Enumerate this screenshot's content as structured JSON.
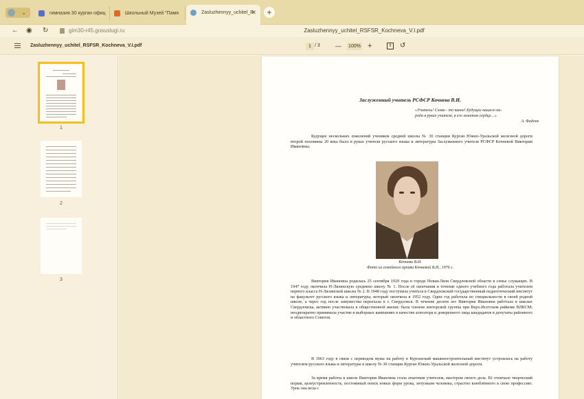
{
  "browser": {
    "tabs": [
      {
        "label": "гимназия 30 курган офиц",
        "favicon_color": "#5b6ec4"
      },
      {
        "label": "Школьный Музей \"Памя",
        "favicon_color": "#d96b2b"
      },
      {
        "label": "Zasluzhennyy_uchitel_R",
        "favicon_color": "#6c9fc9",
        "active": true
      }
    ],
    "newtab_symbol": "+",
    "url": "gim30-r45.gosuslugi.ru",
    "page_title": "Zasluzhennyy_uchitel_RSFSR_Kochneva_V.I.pdf"
  },
  "pdf_toolbar": {
    "document_name": "Zasluzhennyy_uchitel_RSFSR_Kochneva_V.I.pdf",
    "current_page": "1",
    "total_pages": "/ 3",
    "zoom": "100%",
    "zoom_out_symbol": "—",
    "zoom_in_symbol": "+"
  },
  "sidebar": {
    "thumbnails": [
      {
        "label": "1",
        "selected": true
      },
      {
        "label": "2",
        "selected": false
      },
      {
        "label": "3",
        "selected": false
      }
    ]
  },
  "document": {
    "title": "Заслуженный учитель РСФСР Кочнева В.И.",
    "epigraph_lines": [
      "«Учитель! Слово - то какое! Будущее нашего на-",
      "рода в руках учителя, в его золотом сердце…»"
    ],
    "epigraph_author": "А. Фадеев",
    "intro": "Будущее нескольких поколений учеников средней школы № 30 станции Курган Южно-Уральской железной дороги второй половины 20 века было в руках учителя русского языка и литературы Заслуженного учителя РСФСР Кочневой Виктории Ивановны.",
    "photo_caption_name": "Кочнева В.И.",
    "photo_caption_source": "Фото из семейного архива Кочневой В.И., 1976 г.",
    "bio_1": "Виктория Ивановна родилась 25 сентября 1929 года в городе Новая-Ляля Свердловской области в семье служащих. В 1947 году окончила Н-Лялинскую среднюю школу № 1. После её окончания в течение одного учебного года работала учителем первого класса Н-Лялинской школы № 2. В 1948 году поступила учиться в Свердловский государственный педагогический институт на факультет русского языка и литературы, который окончила в 1952 году. Один год работала по специальности в своей родной школе, а через год после замужества переехала в г. Свердловск. В течение десяти лет Виктория Ивановна работала в школах Свердловска, активно участвовала в общественной жизни: была членом лекторской группы при Верх-Исетском райкоме ВЛКСМ; неоднократно принимала участие в выборных кампаниях в качестве агитатора и доверенного лица кандидатов в депутаты районного и областного Советов.",
    "bio_2": "В 1963 году в связи с переводом мужа на работу в Курганский машиностроительный институт устроилась на работу учителем русского языка и литературы в школу № 30 станции Курган Южно-Уральской железной дороги.",
    "bio_3": "За время работы в школе Виктория Ивановна стала опытным учителем, мастером своего дела. Её отличало творческий порыв, целеустремленность, постоянный поиск новых форм урока, энтузиазм человека, страстно влюблённого в свою профессию. Урок она вела с"
  }
}
